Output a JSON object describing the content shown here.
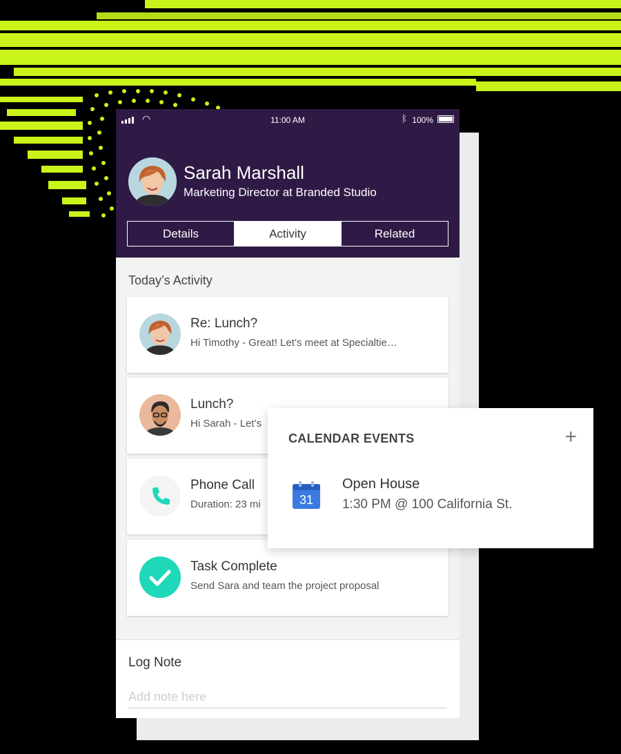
{
  "status_bar": {
    "time": "11:00 AM",
    "battery": "100%"
  },
  "contact": {
    "name": "Sarah Marshall",
    "title": "Marketing Director at Branded Studio"
  },
  "tabs": [
    {
      "label": "Details"
    },
    {
      "label": "Activity",
      "active": true
    },
    {
      "label": "Related"
    }
  ],
  "activity": {
    "section_title": "Today’s Activity",
    "items": [
      {
        "title": "Re: Lunch?",
        "subtitle": "Hi Timothy -  Great! Let’s meet at Specialtie…",
        "icon": "avatar-sarah"
      },
      {
        "title": "Lunch?",
        "subtitle": "Hi Sarah - Let’s",
        "icon": "avatar-man"
      },
      {
        "title": "Phone Call",
        "subtitle": "Duration: 23 mi",
        "icon": "phone-icon"
      },
      {
        "title": "Task Complete",
        "subtitle": "Send Sara and team the project proposal",
        "icon": "check-icon"
      }
    ]
  },
  "log_note": {
    "title": "Log Note",
    "placeholder": "Add note here"
  },
  "calendar": {
    "title": "CALENDAR EVENTS",
    "add_icon": "plus-icon",
    "event": {
      "day": "31",
      "title": "Open House",
      "details": "1:30 PM @ 100 California St."
    }
  },
  "colors": {
    "header": "#2f1a45",
    "accent": "#c9f41a",
    "teal": "#1fd8b9"
  }
}
